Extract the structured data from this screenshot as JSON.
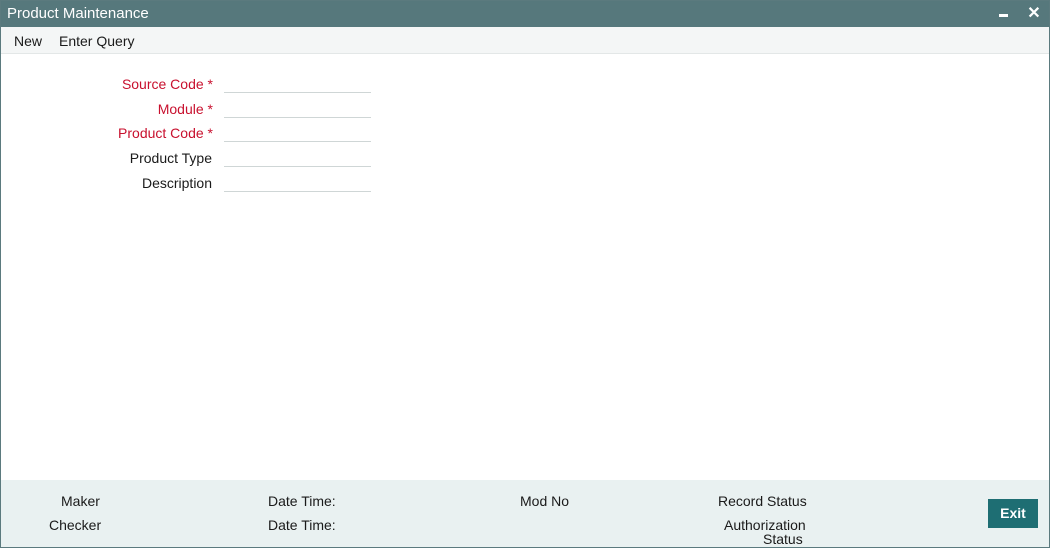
{
  "window": {
    "title": "Product Maintenance",
    "minimize_symbol": "",
    "close_symbol": "✕"
  },
  "toolbar": {
    "new_label": "New",
    "enter_query_label": "Enter Query"
  },
  "form": {
    "required_marker": "*",
    "fields": [
      {
        "label": "Source Code",
        "required": true,
        "value": ""
      },
      {
        "label": "Module",
        "required": true,
        "value": ""
      },
      {
        "label": "Product Code",
        "required": true,
        "value": ""
      },
      {
        "label": "Product Type",
        "required": false,
        "value": ""
      },
      {
        "label": "Description",
        "required": false,
        "value": ""
      }
    ]
  },
  "footer": {
    "maker_label": "Maker",
    "checker_label": "Checker",
    "date_time_label_1": "Date Time:",
    "date_time_label_2": "Date Time:",
    "mod_no_label": "Mod No",
    "record_status_label": "Record Status",
    "authorization_status_line1": "Authorization",
    "authorization_status_line2": "Status",
    "exit_label": "Exit"
  },
  "colors": {
    "titlebar": "#56787c",
    "required": "#c8102e",
    "footer": "#e9f1f1",
    "exit_button": "#1e6e73"
  },
  "icons": {
    "minimize": "minimize-icon",
    "close": "close-icon"
  }
}
